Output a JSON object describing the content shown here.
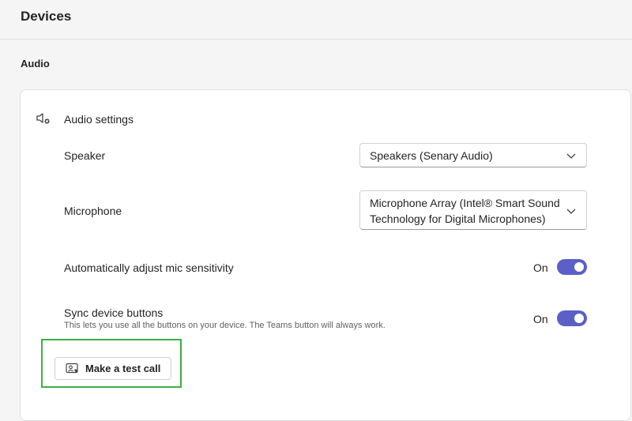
{
  "page": {
    "title": "Devices"
  },
  "audio": {
    "section_title": "Audio",
    "settings_label": "Audio settings",
    "speaker": {
      "label": "Speaker",
      "selected": "Speakers (Senary Audio)"
    },
    "microphone": {
      "label": "Microphone",
      "selected_line1": "Microphone Array (Intel® Smart Sound",
      "selected_line2": "Technology for Digital Microphones)"
    },
    "auto_adjust": {
      "label": "Automatically adjust mic sensitivity",
      "state": "On",
      "enabled": true
    },
    "sync_buttons": {
      "label": "Sync device buttons",
      "description": "This lets you use all the buttons on your device. The Teams button will always work.",
      "state": "On",
      "enabled": true
    },
    "test_call": {
      "label": "Make a test call"
    }
  },
  "icons": {
    "settings": "speaker-gear-icon",
    "dropdown": "chevron-down-icon",
    "test_call": "test-call-icon"
  },
  "colors": {
    "toggle_on": "#5b5fc7",
    "highlight": "#3cb043"
  }
}
